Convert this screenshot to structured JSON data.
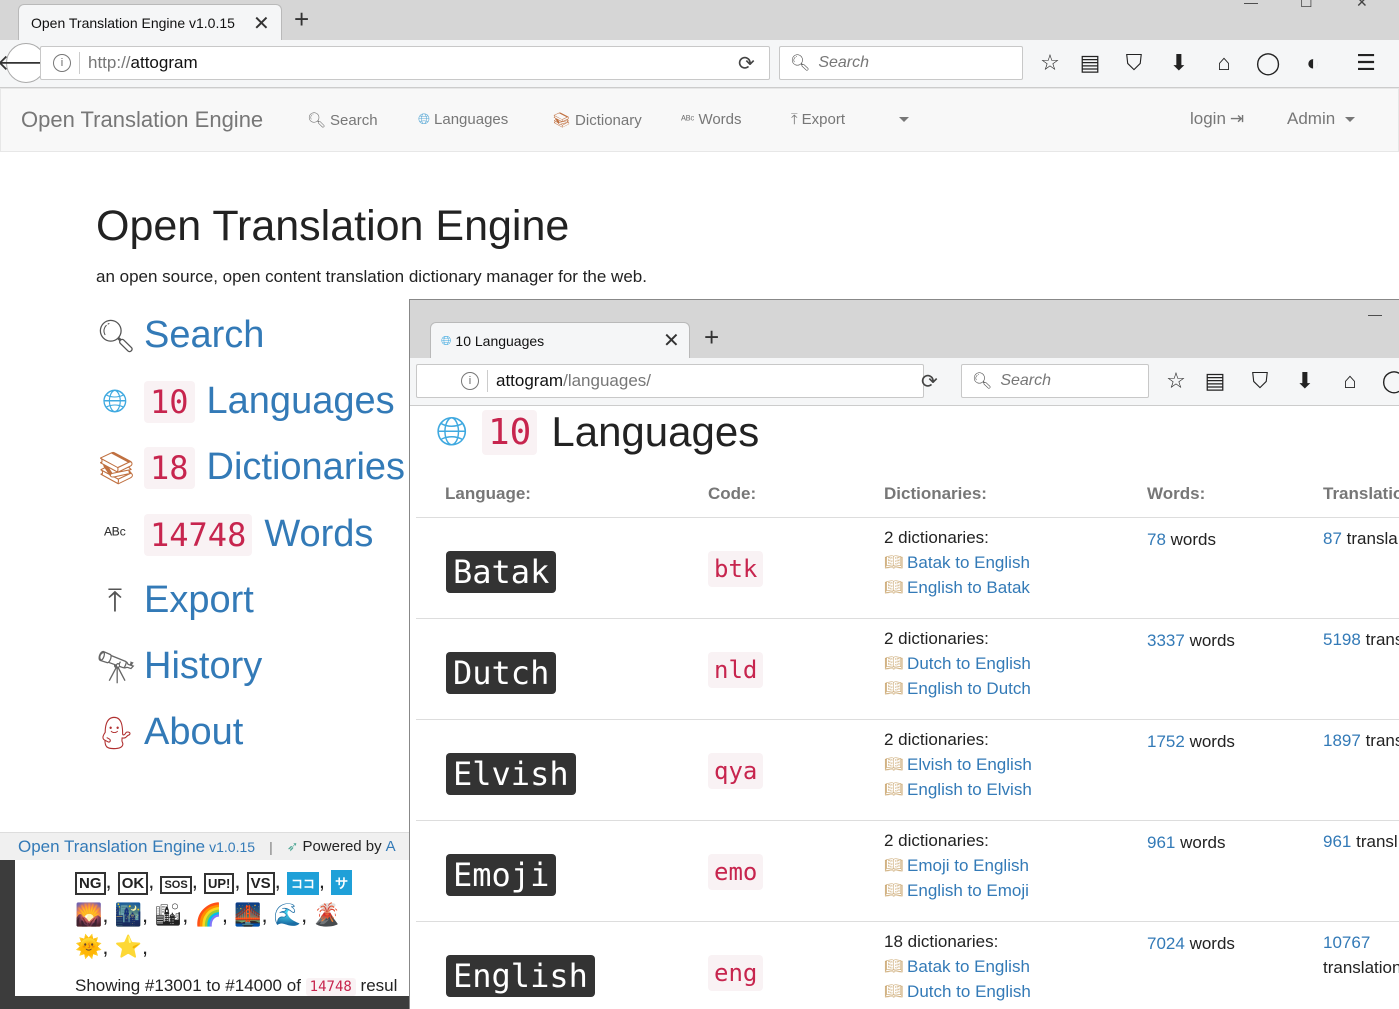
{
  "window1": {
    "tab_title": "Open Translation Engine v1.0.15",
    "url_prefix": "http://",
    "url_host": "attogram",
    "search_placeholder": "Search",
    "navbar": {
      "brand": "Open Translation Engine",
      "items": [
        {
          "label": "Search",
          "icon": "search-icon"
        },
        {
          "label": "Languages",
          "icon": "globe-icon"
        },
        {
          "label": "Dictionary",
          "icon": "books-icon"
        },
        {
          "label": "Words",
          "icon": "abc-icon"
        },
        {
          "label": "Export",
          "icon": "upload-icon"
        }
      ],
      "login": "login",
      "admin": "Admin"
    },
    "hero_title": "Open Translation Engine",
    "hero_subtitle": "an open source, open content translation dictionary manager for the web.",
    "menu": {
      "search": "Search",
      "languages_count": "10",
      "languages": "Languages",
      "dictionaries_count": "18",
      "dictionaries": "Dictionaries",
      "words_count": "14748",
      "words": "Words",
      "export": "Export",
      "history": "History",
      "about": "About"
    },
    "footer": {
      "brand": "Open Translation Engine",
      "version": "v1.0.15",
      "separator": "|",
      "powered": "Powered by",
      "powered_link": "A"
    },
    "emoji_row1": [
      "NG",
      "OK",
      "SOS",
      "UP!",
      "VS",
      "ココ",
      "サ"
    ],
    "emoji_row2": [
      "🌄",
      "🌃",
      "🏙",
      "🌈",
      "🌉",
      "🌊",
      "🌋"
    ],
    "emoji_row3": [
      "🌞",
      "⭐"
    ],
    "showing_prefix": "Showing #13001 to #14000 of",
    "showing_count": "14748",
    "showing_suffix": "resul"
  },
  "window2": {
    "tab_title": "10 Languages",
    "url_host": "attogram",
    "url_path": "/languages/",
    "search_placeholder": "Search",
    "title_count": "10",
    "title": "Languages",
    "headers": {
      "language": "Language:",
      "code": "Code:",
      "dictionaries": "Dictionaries:",
      "words": "Words:",
      "translations": "Translatio"
    },
    "rows": [
      {
        "language": "Batak",
        "code": "btk",
        "dict_count": "2 dictionaries:",
        "dicts": [
          "Batak to English",
          "English to Batak"
        ],
        "words_num": "78",
        "words_label": "words",
        "trans_num": "87",
        "trans_label": "transla"
      },
      {
        "language": "Dutch",
        "code": "nld",
        "dict_count": "2 dictionaries:",
        "dicts": [
          "Dutch to English",
          "English to Dutch"
        ],
        "words_num": "3337",
        "words_label": "words",
        "trans_num": "5198",
        "trans_label": "trans"
      },
      {
        "language": "Elvish",
        "code": "qya",
        "dict_count": "2 dictionaries:",
        "dicts": [
          "Elvish to English",
          "English to Elvish"
        ],
        "words_num": "1752",
        "words_label": "words",
        "trans_num": "1897",
        "trans_label": "trans"
      },
      {
        "language": "Emoji",
        "code": "emo",
        "dict_count": "2 dictionaries:",
        "dicts": [
          "Emoji to English",
          "English to Emoji"
        ],
        "words_num": "961",
        "words_label": "words",
        "trans_num": "961",
        "trans_label": "transl"
      },
      {
        "language": "English",
        "code": "eng",
        "dict_count": "18 dictionaries:",
        "dicts": [
          "Batak to English",
          "Dutch to English"
        ],
        "words_num": "7024",
        "words_label": "words",
        "trans_num": "10767",
        "trans_label": "translation"
      }
    ]
  }
}
